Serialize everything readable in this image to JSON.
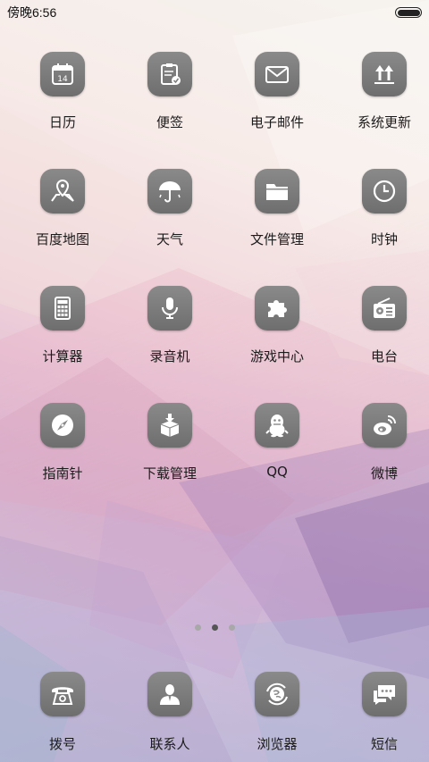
{
  "status_bar": {
    "time": "傍晚6:56"
  },
  "apps": [
    {
      "label": "日历",
      "icon": "calendar-icon",
      "icon_text": "14"
    },
    {
      "label": "便签",
      "icon": "notes-icon"
    },
    {
      "label": "电子邮件",
      "icon": "mail-icon"
    },
    {
      "label": "系统更新",
      "icon": "update-icon"
    },
    {
      "label": "百度地图",
      "icon": "map-icon"
    },
    {
      "label": "天气",
      "icon": "umbrella-icon"
    },
    {
      "label": "文件管理",
      "icon": "folder-icon"
    },
    {
      "label": "时钟",
      "icon": "clock-icon"
    },
    {
      "label": "计算器",
      "icon": "calculator-icon"
    },
    {
      "label": "录音机",
      "icon": "microphone-icon"
    },
    {
      "label": "游戏中心",
      "icon": "puzzle-icon"
    },
    {
      "label": "电台",
      "icon": "radio-icon"
    },
    {
      "label": "指南针",
      "icon": "compass-icon"
    },
    {
      "label": "下载管理",
      "icon": "download-box-icon"
    },
    {
      "label": "QQ",
      "icon": "penguin-icon"
    },
    {
      "label": "微博",
      "icon": "weibo-icon"
    }
  ],
  "page_indicator": {
    "count": 3,
    "active_index": 1
  },
  "dock": [
    {
      "label": "拨号",
      "icon": "phone-icon"
    },
    {
      "label": "联系人",
      "icon": "contact-icon"
    },
    {
      "label": "浏览器",
      "icon": "browser-icon"
    },
    {
      "label": "短信",
      "icon": "message-icon"
    }
  ],
  "colors": {
    "icon_tile": "#7b7b7b",
    "label_text": "#1b1b1b"
  }
}
